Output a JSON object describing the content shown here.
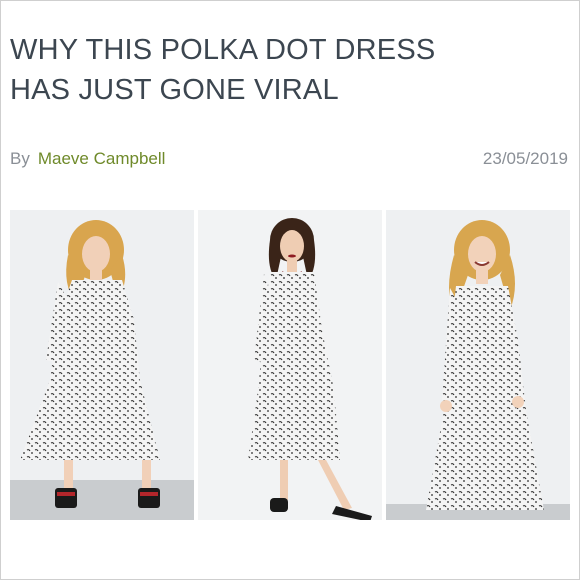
{
  "article": {
    "headline_line1": "WHY THIS POLKA DOT DRESS",
    "headline_line2": "HAS JUST GONE VIRAL",
    "byline_prefix": "By",
    "author": "Maeve Campbell",
    "date": "23/05/2019"
  },
  "images": [
    {
      "icon": "model-photo-blonde-sandals"
    },
    {
      "icon": "model-photo-brunette-slides"
    },
    {
      "icon": "model-photo-blonde-smiling"
    }
  ],
  "colors": {
    "headline": "#3c4650",
    "author_link": "#6f8a2a",
    "meta": "#8a8f96",
    "dress": "#f4f4f4",
    "dots": "#2a2a2a"
  }
}
